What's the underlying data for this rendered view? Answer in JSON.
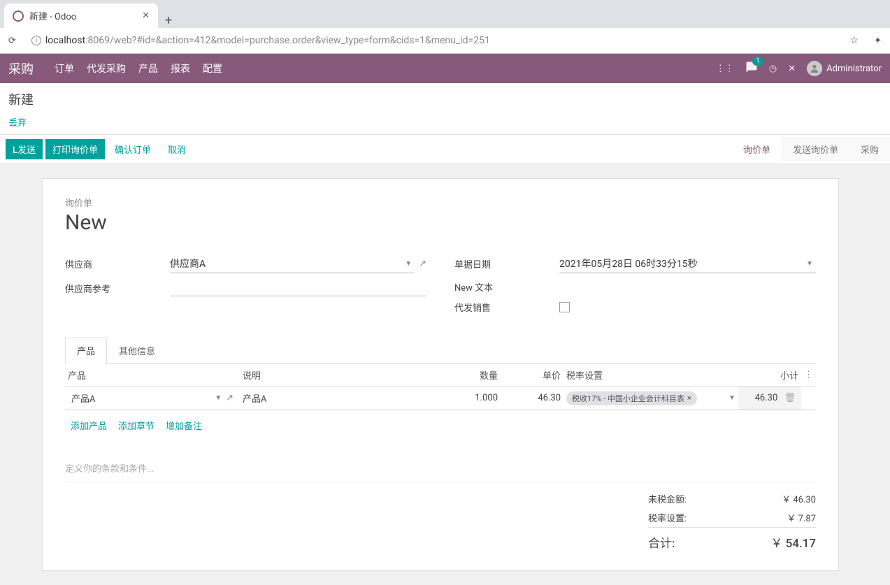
{
  "browser": {
    "tab_title": "新建 - Odoo",
    "url_host": "localhost",
    "url_port": ":8069",
    "url_path": "/web?#id=&action=412&model=purchase.order&view_type=form&cids=1&menu_id=251"
  },
  "nav": {
    "brand": "采购",
    "items": [
      "订单",
      "代发采购",
      "产品",
      "报表",
      "配置"
    ],
    "msg_count": "1",
    "user": "Administrator"
  },
  "controlPanel": {
    "breadcrumb": "新建",
    "discard": "丢弃"
  },
  "statusBar": {
    "buttons": {
      "send": "L发送",
      "print": "打印询价单",
      "confirm": "确认订单",
      "cancel": "取消"
    },
    "steps": {
      "rfq": "询价单",
      "sent": "发送询价单",
      "po": "采购"
    }
  },
  "form": {
    "docTypeLabel": "询价单",
    "docName": "New",
    "fields": {
      "vendor_label": "供应商",
      "vendor_value": "供应商A",
      "vendor_ref_label": "供应商参考",
      "date_label": "单据日期",
      "date_value": "2021年05月28日 06时33分15秒",
      "newtext_label": "New 文本",
      "dropship_label": "代发销售"
    },
    "tabs": {
      "products": "产品",
      "other": "其他信息"
    },
    "columns": {
      "product": "产品",
      "desc": "说明",
      "qty": "数量",
      "price": "单价",
      "taxes": "税率设置",
      "subtotal": "小计"
    },
    "line": {
      "product": "产品A",
      "desc": "产品A",
      "qty": "1.000",
      "price": "46.30",
      "tax": "税收17% - 中国小企业会计科目表",
      "subtotal": "46.30"
    },
    "tableLinks": {
      "addProduct": "添加产品",
      "addSection": "添加章节",
      "addNote": "增加备注"
    },
    "terms_placeholder": "定义你的条款和条件...",
    "totals": {
      "untaxed_label": "未税金额:",
      "untaxed_value": "￥ 46.30",
      "tax_label": "税率设置:",
      "tax_value": "￥ 7.87",
      "total_label": "合计:",
      "total_value": "￥ 54.17"
    }
  }
}
